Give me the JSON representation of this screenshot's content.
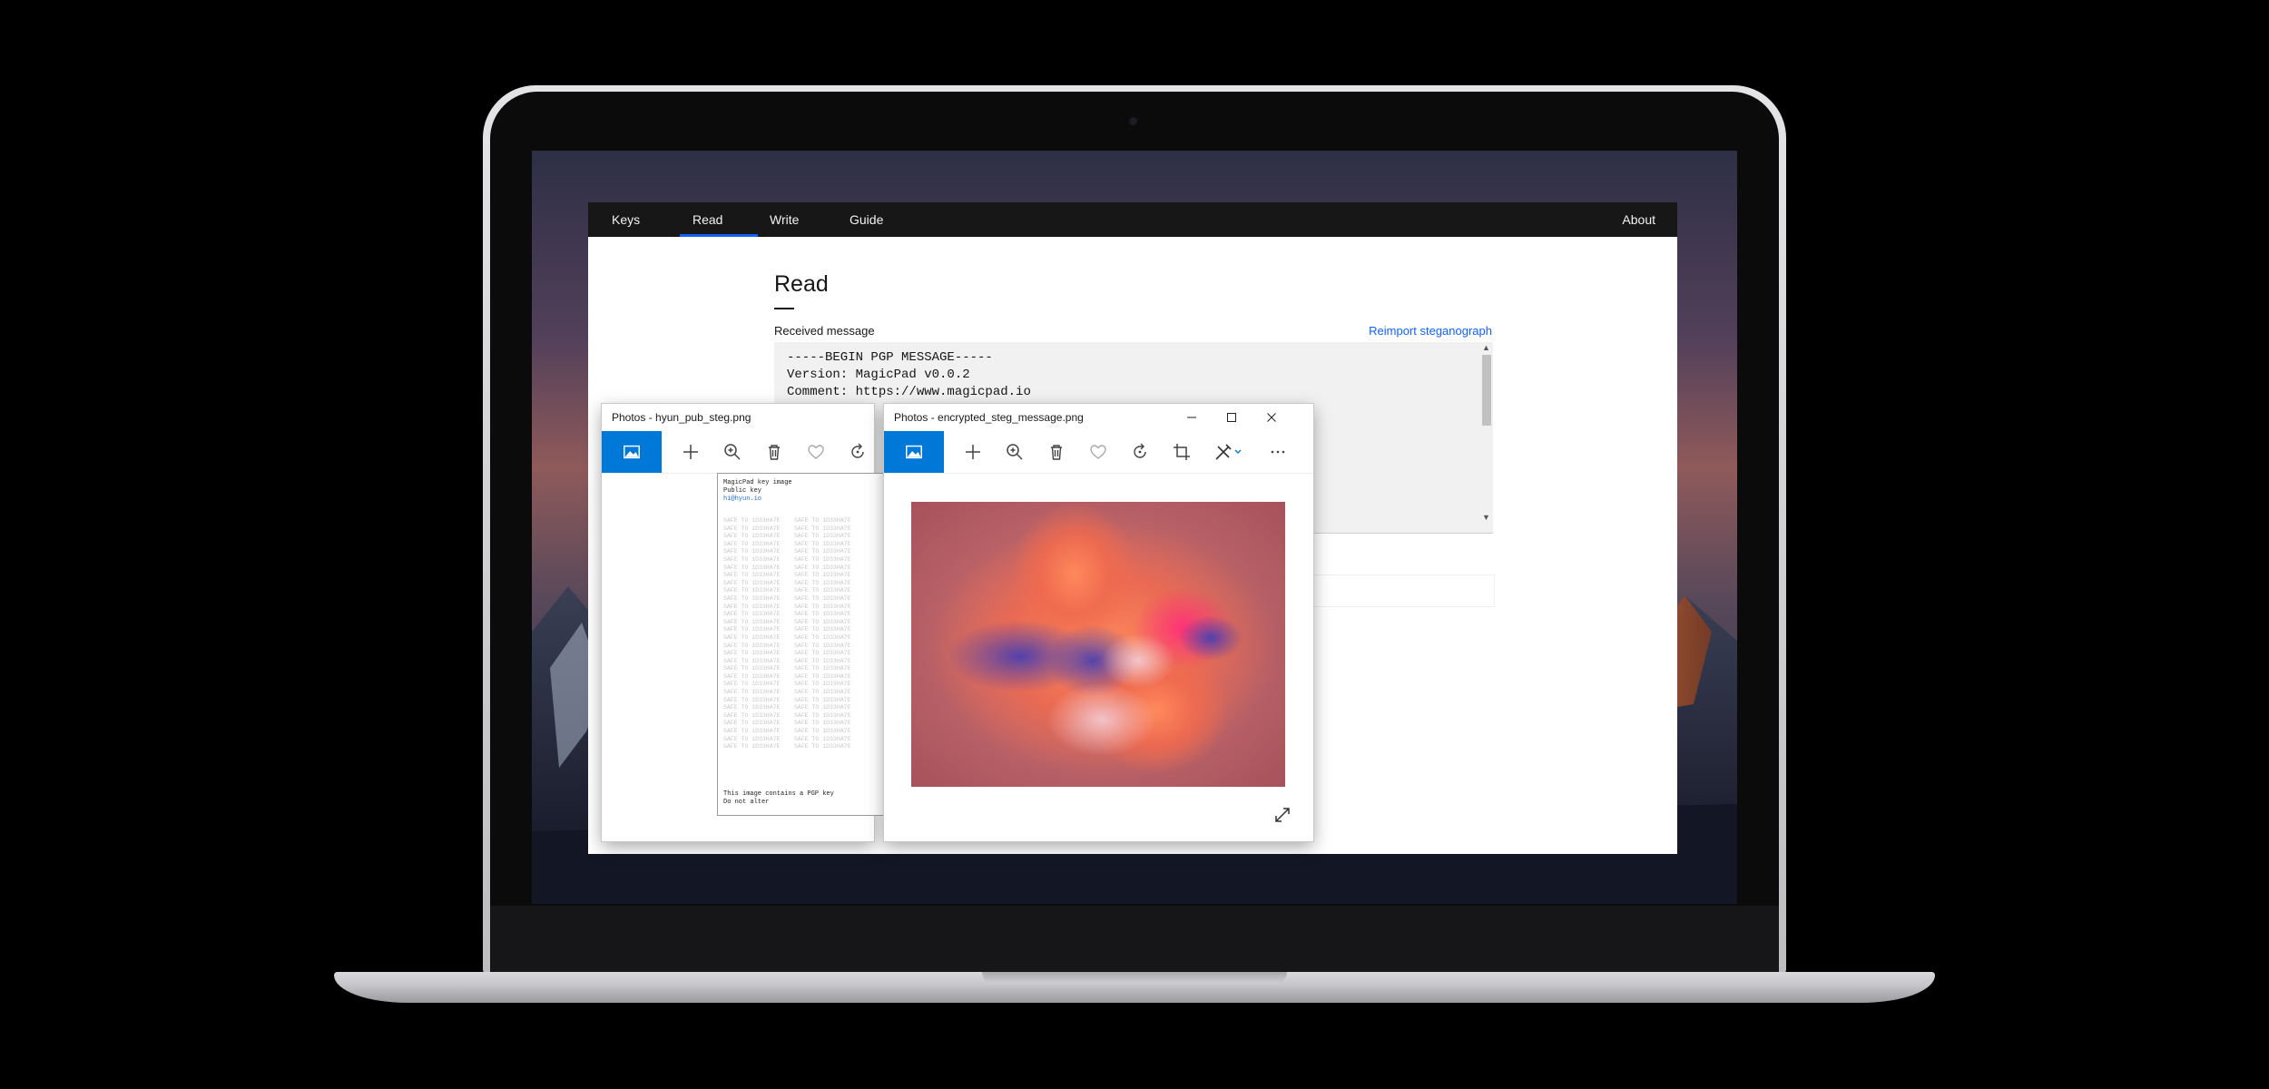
{
  "app": {
    "nav": {
      "items": [
        "Keys",
        "Read",
        "Write",
        "Guide"
      ],
      "right_item": "About",
      "active_item": "Read"
    },
    "page": {
      "title": "Read",
      "received_label": "Received message",
      "reimport_link": "Reimport steganograph",
      "message_lines": [
        "-----BEGIN PGP MESSAGE-----",
        "Version: MagicPad v0.0.2",
        "Comment: https://www.magicpad.io"
      ]
    }
  },
  "windows": {
    "key_image": {
      "title": "Photos - hyun_pub_steg.png",
      "image_lines": [
        "MagicPad key image",
        "Public key",
        "hi@hyun.io"
      ],
      "image_footer": [
        "This image contains a PGP key",
        "Do not alter"
      ]
    },
    "message_image": {
      "title": "Photos - encrypted_steg_message.png"
    }
  },
  "icons": {
    "gallery": "gallery-icon",
    "add": "plus-icon",
    "zoom": "zoom-icon",
    "delete": "trash-icon",
    "favorite": "heart-icon",
    "rotate": "rotate-icon",
    "crop": "crop-icon",
    "edit": "edit-tools-icon",
    "more": "more-icon",
    "expand": "expand-icon"
  },
  "colors": {
    "accent": "#0f62fe",
    "photos_accent": "#0078d7",
    "navbar": "#171717"
  }
}
